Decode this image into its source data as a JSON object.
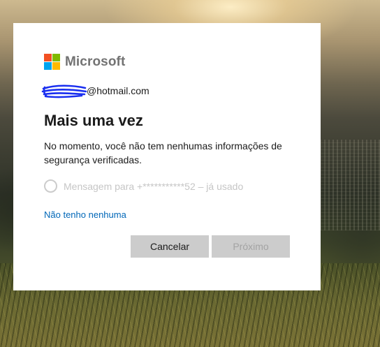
{
  "brand": {
    "name": "Microsoft",
    "logo_colors": [
      "#f25022",
      "#7fba00",
      "#00a4ef",
      "#ffb900"
    ]
  },
  "account": {
    "email_visible": "@hotmail.com",
    "redaction_color": "#1a2ff0"
  },
  "title": "Mais uma vez",
  "description": "No momento, você não tem nenhumas informações de segurança verificadas.",
  "option": {
    "label": "Mensagem para +***********52 – já usado",
    "selected": false,
    "disabled": true
  },
  "link": {
    "label": "Não tenho nenhuma"
  },
  "buttons": {
    "cancel": "Cancelar",
    "next": "Próximo"
  },
  "colors": {
    "link": "#0067b8",
    "button_bg": "#cccccc",
    "disabled_text": "#c6c6c6"
  }
}
